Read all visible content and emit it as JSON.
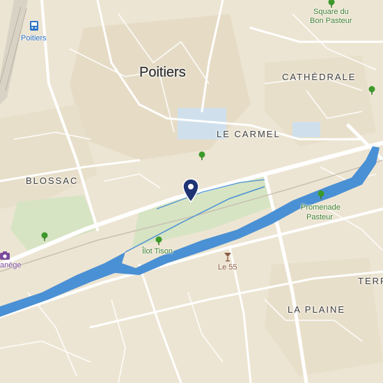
{
  "map": {
    "city": "Poitiers",
    "districts": {
      "cathedrale": "CATHÉDRALE",
      "le_carmel": "LE CARMEL",
      "blossac": "BLOSSAC",
      "la_plaine": "LA PLAINE",
      "terre_partial": "TERR"
    },
    "parks": {
      "square_line1": "Square du",
      "square_line2": "Bon Pasteur",
      "promenade_line1": "Promenade",
      "promenade_line2": "Pasteur",
      "ilot": "Îlot Tison"
    },
    "pois": {
      "bar": "Le 55",
      "museum_partial": "anège"
    },
    "station": "Poitiers",
    "icons": [
      "train-station-icon",
      "tree-icon",
      "bar-icon",
      "camera-icon",
      "map-pin-icon"
    ],
    "colors": {
      "land": "#ede5d3",
      "river": "#4a90d4",
      "park": "#d6e4c3",
      "road": "#ffffff",
      "marker": "#1f3473",
      "park_label": "#3c7d2a"
    }
  }
}
